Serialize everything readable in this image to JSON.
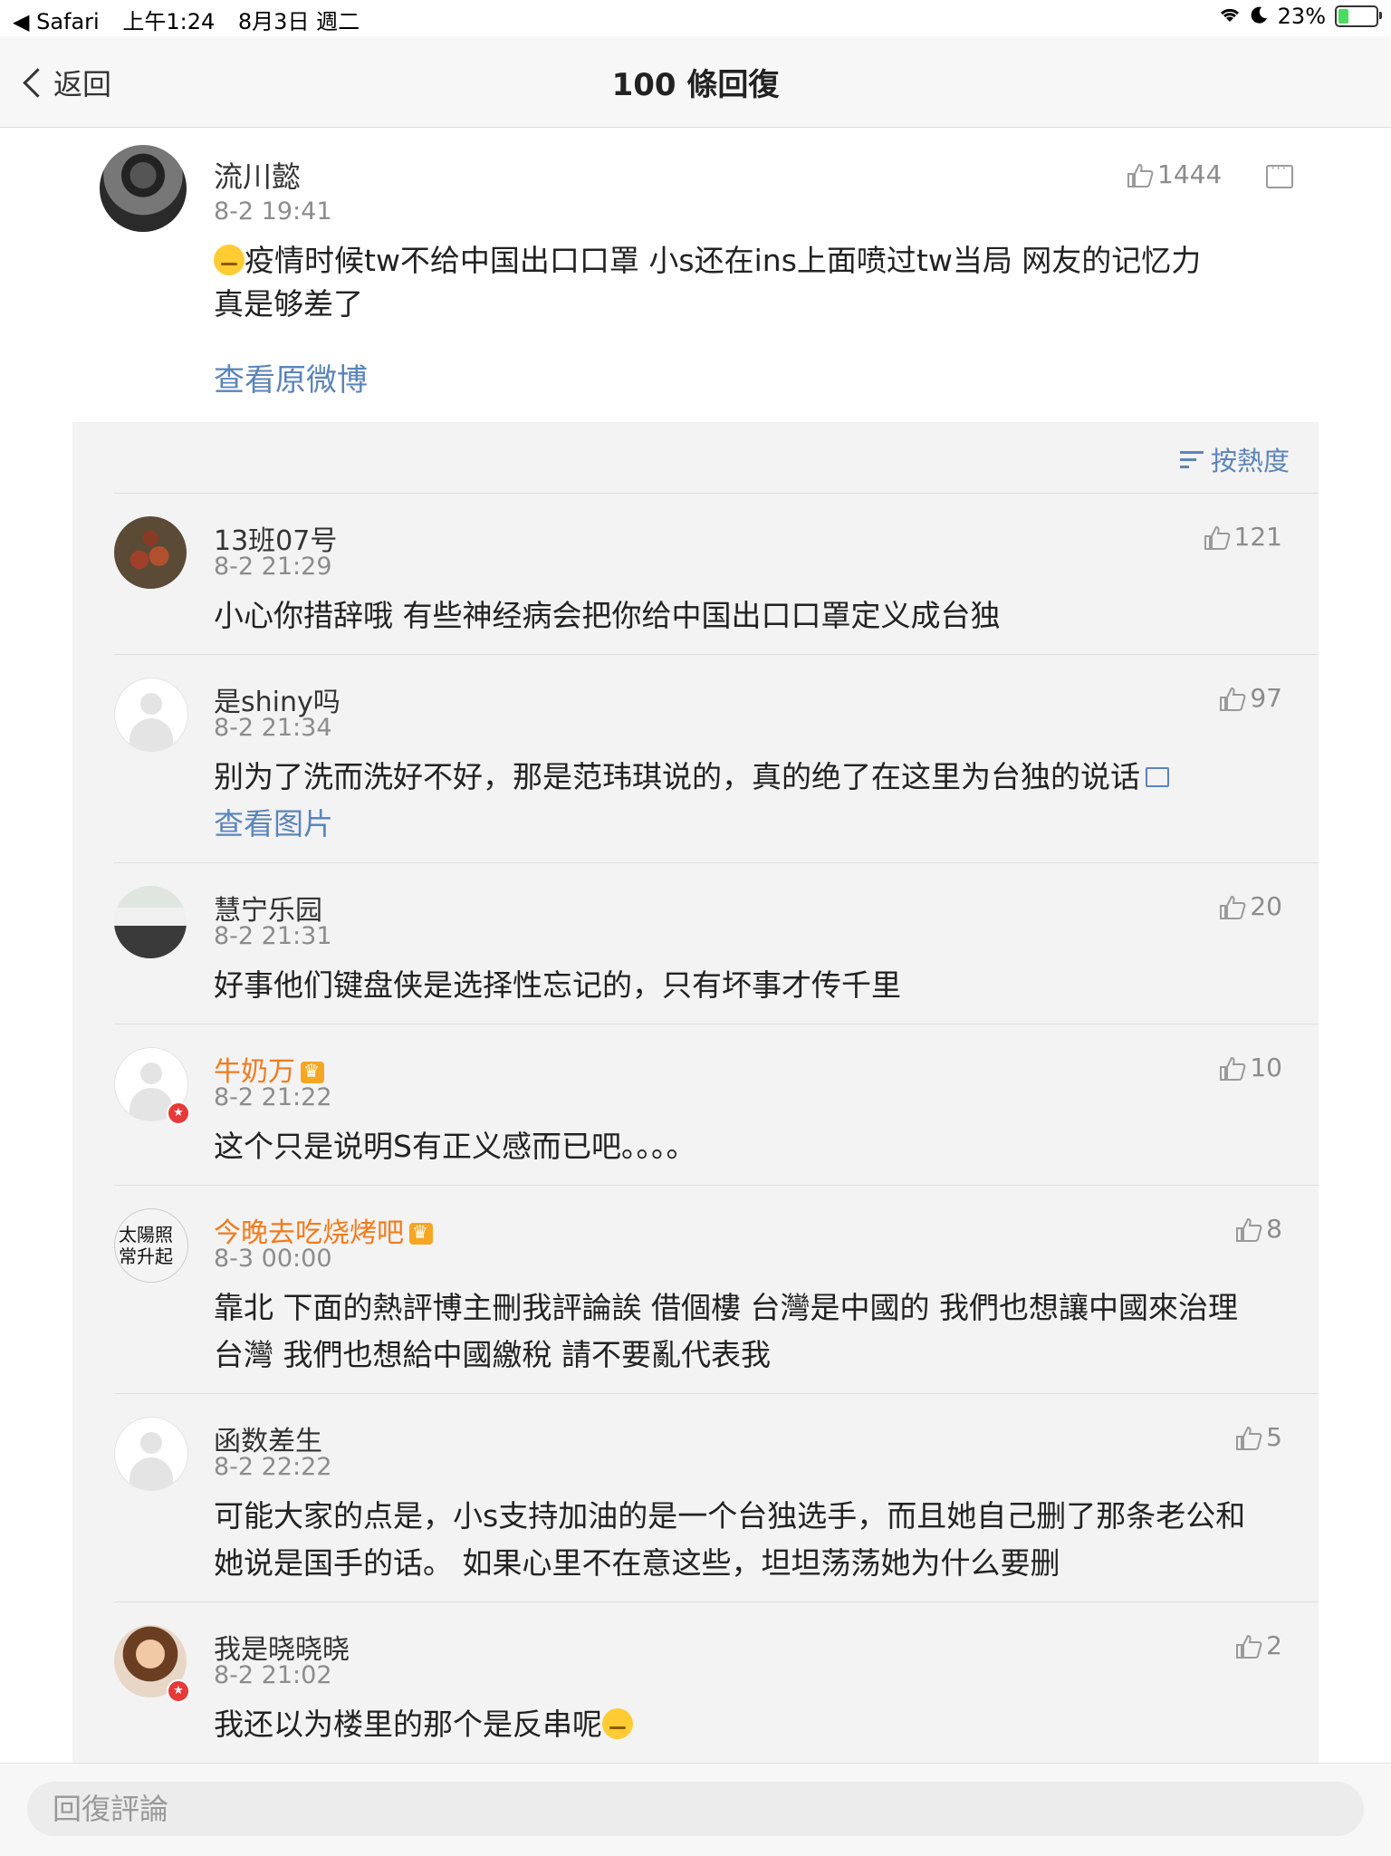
{
  "status": {
    "app": "◀ Safari",
    "time": "上午1:24",
    "date": "8月3日 週二",
    "battery": "23%"
  },
  "nav": {
    "back_label": "返回",
    "title": "100 條回復"
  },
  "post": {
    "author": "流川懿",
    "time": "8-2 19:41",
    "likes": "1444",
    "text": "疫情时候tw不给中国出口口罩 小s还在ins上面喷过tw当局 网友的记忆力真是够差了",
    "view_original": "查看原微博"
  },
  "sort_label": "按熱度",
  "comments": [
    {
      "name": "13班07号",
      "time": "8-2 21:29",
      "likes": "121",
      "text": "小心你措辞哦 有些神经病会把你给中国出口口罩定义成台独"
    },
    {
      "name": "是shiny吗",
      "time": "8-2 21:34",
      "likes": "97",
      "text": "别为了洗而洗好不好，那是范玮琪说的，真的绝了在这里为台独的说话",
      "link": "查看图片"
    },
    {
      "name": "慧宁乐园",
      "time": "8-2 21:31",
      "likes": "20",
      "text": "好事他们键盘侠是选择性忘记的，只有坏事才传千里"
    },
    {
      "name": "牛奶万",
      "time": "8-2 21:22",
      "likes": "10",
      "text": "这个只是说明S有正义感而已吧。。。。"
    },
    {
      "name": "今晚去吃烧烤吧",
      "time": "8-3 00:00",
      "likes": "8",
      "text": "靠北 下面的熱評博主刪我評論誒 借個樓 台灣是中國的 我們也想讓中國來治理台灣 我們也想給中國繳稅 請不要亂代表我",
      "avatar_text": "太陽照常升起"
    },
    {
      "name": "函数差生",
      "time": "8-2 22:22",
      "likes": "5",
      "text": "可能大家的点是，小s支持加油的是一个台独选手，而且她自己删了那条老公和她说是国手的话。 如果心里不在意这些，坦坦荡荡她为什么要删"
    },
    {
      "name": "我是晓晓晓",
      "time": "8-2 21:02",
      "likes": "2",
      "text": "我还以为楼里的那个是反串呢"
    }
  ],
  "reply": {
    "placeholder": "回復評論"
  },
  "colors": {
    "link": "#5b84ba",
    "vip_name": "#f07b1e"
  }
}
